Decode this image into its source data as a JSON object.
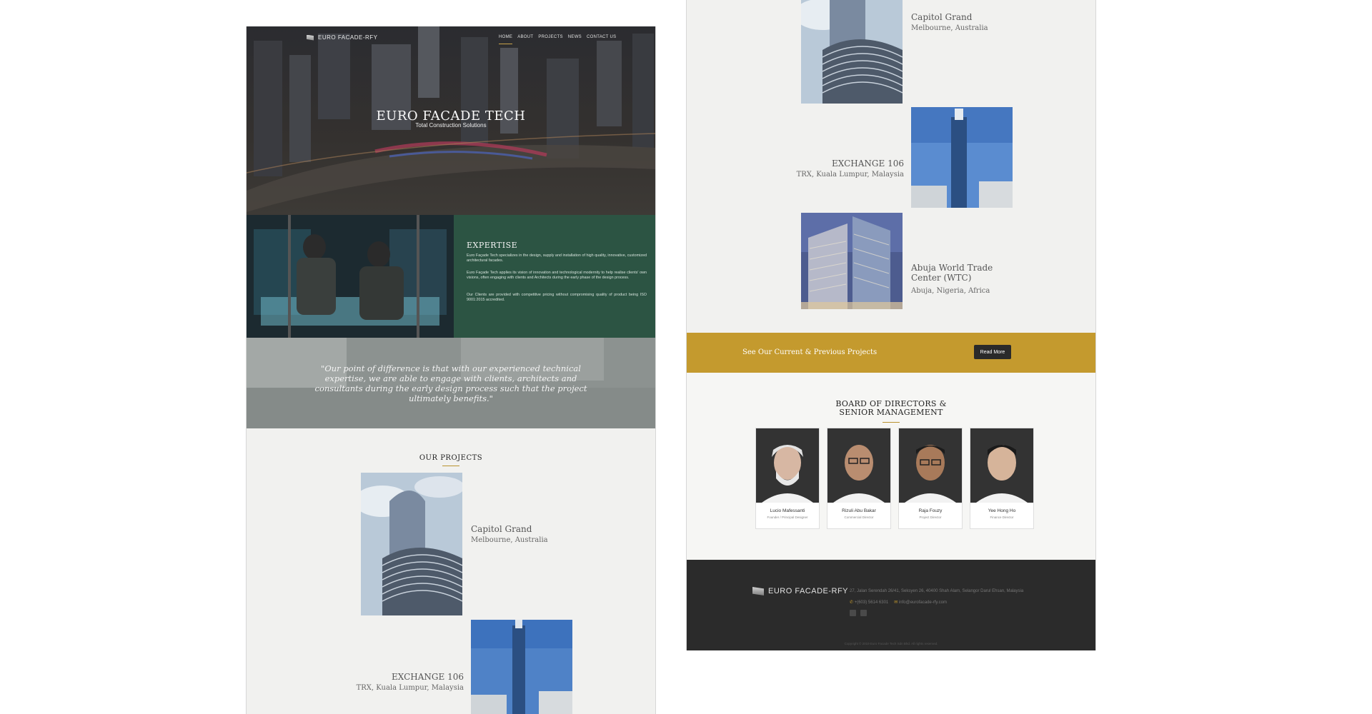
{
  "nav": {
    "logo": "EURO FACADE-RFY",
    "items": [
      "HOME",
      "ABOUT",
      "PROJECTS",
      "NEWS",
      "CONTACT US"
    ]
  },
  "hero": {
    "title": "EURO FACADE TECH",
    "subtitle": "Total Construction Solutions"
  },
  "expertise": {
    "title": "EXPERTISE",
    "paragraphs": [
      "Euro Façade Tech specializes in the design, supply and installation of high quality, innovative, customized architectural facades.",
      "Euro Façade Tech applies its vision of innovation and technological modernity to help realise clients' own visions, often engaging with clients and Architects during the early phase of the design process.",
      "Our Clients are provided with competitive pricing without compromising quality of product being ISO 9001:2015 accredited."
    ]
  },
  "quote": "\"Our point of difference is that with our experienced technical expertise, we are able to engage with clients, architects and consultants during the early design process such that the project ultimately benefits.\"",
  "projects_title": "OUR PROJECTS",
  "projects": [
    {
      "name": "Capitol Grand",
      "location": "Melbourne, Australia"
    },
    {
      "name": "EXCHANGE 106",
      "location": "TRX, Kuala Lumpur, Malaysia"
    },
    {
      "name": "Abuja World Trade Center (WTC)",
      "location": "Abuja, Nigeria, Africa"
    }
  ],
  "cta": {
    "text": "See Our Current & Previous Projects",
    "button": "Read More"
  },
  "board": {
    "title_line1": "BOARD OF DIRECTORS &",
    "title_line2": "SENIOR MANAGEMENT",
    "members": [
      {
        "name": "Lucio Mafessanti",
        "role": "Founder / Principal Designer"
      },
      {
        "name": "Rizuli Abu Bakar",
        "role": "Commercial Director"
      },
      {
        "name": "Raja Fouzy",
        "role": "Project Director"
      },
      {
        "name": "Yee Hong Ho",
        "role": "Finance Director"
      }
    ]
  },
  "footer": {
    "logo": "EURO FACADE-RFY",
    "address": "27, Jalan Serendah 26/41, Seksyen 26, 40400 Shah Alam, Selangor Darul Ehsan, Malaysia",
    "phone": "+(603) 5614 6301",
    "email": "info@eurofacade-rfy.com",
    "copyright": "Copyright © 2019 Euro Facade Tech Sdn Bhd. All rights reserved."
  },
  "colors": {
    "accent_gold": "#c49a2e",
    "expertise_green": "#2c5443",
    "footer_dark": "#2b2b2b"
  }
}
